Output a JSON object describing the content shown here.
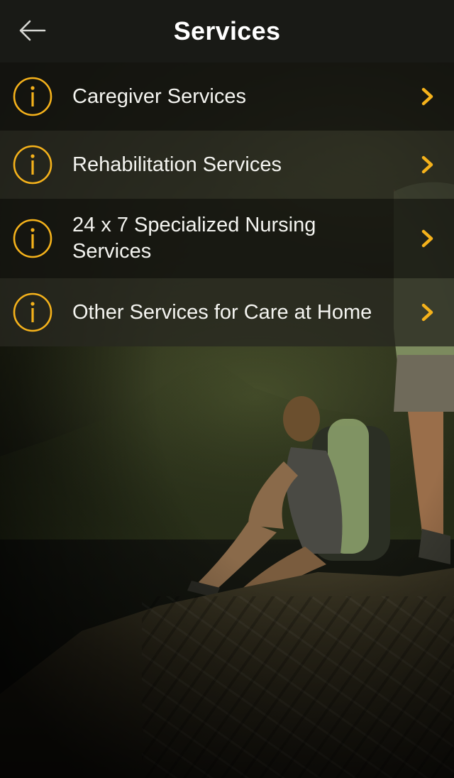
{
  "header": {
    "title": "Services",
    "back_icon": "arrow-left-icon"
  },
  "colors": {
    "accent": "#F5B21B",
    "header_bg": "#191A16",
    "text": "#FFFFFF"
  },
  "services": [
    {
      "label": "Caregiver Services",
      "icon": "info-icon",
      "chevron": "chevron-right-icon"
    },
    {
      "label": "Rehabilitation Services",
      "icon": "info-icon",
      "chevron": "chevron-right-icon"
    },
    {
      "label": "24 x 7 Specialized Nursing Services",
      "icon": "info-icon",
      "chevron": "chevron-right-icon"
    },
    {
      "label": "Other Services for Care at Home",
      "icon": "info-icon",
      "chevron": "chevron-right-icon"
    }
  ]
}
